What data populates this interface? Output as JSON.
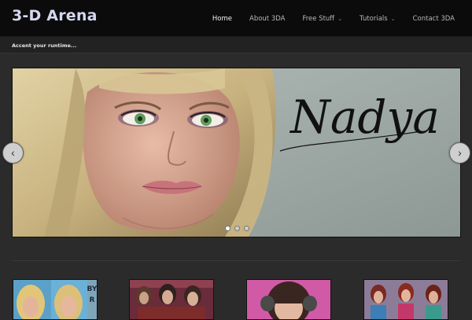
{
  "site": {
    "logo": "3-D Arena",
    "tagline": "Accent your runtime..."
  },
  "nav": {
    "items": [
      {
        "label": "Home",
        "active": true,
        "dropdown": false
      },
      {
        "label": "About 3DA",
        "active": false,
        "dropdown": false
      },
      {
        "label": "Free Stuff",
        "active": false,
        "dropdown": true
      },
      {
        "label": "Tutorials",
        "active": false,
        "dropdown": true
      },
      {
        "label": "Contact 3DA",
        "active": false,
        "dropdown": false
      }
    ],
    "caret_glyph": "⌄"
  },
  "slider": {
    "slide_text": "Nadya",
    "prev_icon": "‹",
    "next_icon": "›",
    "dots": [
      true,
      false,
      false
    ],
    "colors": {
      "background": "#9aa6a2",
      "hair": "#cdb98a",
      "skin": "#d7a891",
      "eyes": "#5c9e5a",
      "lips": "#c8737b"
    }
  },
  "thumbnails": [
    {
      "name": "thumb-blonde-pair",
      "badge_text": "BY\nR"
    },
    {
      "name": "thumb-three-women"
    },
    {
      "name": "thumb-bangs-girl"
    },
    {
      "name": "thumb-three-redheads"
    }
  ]
}
